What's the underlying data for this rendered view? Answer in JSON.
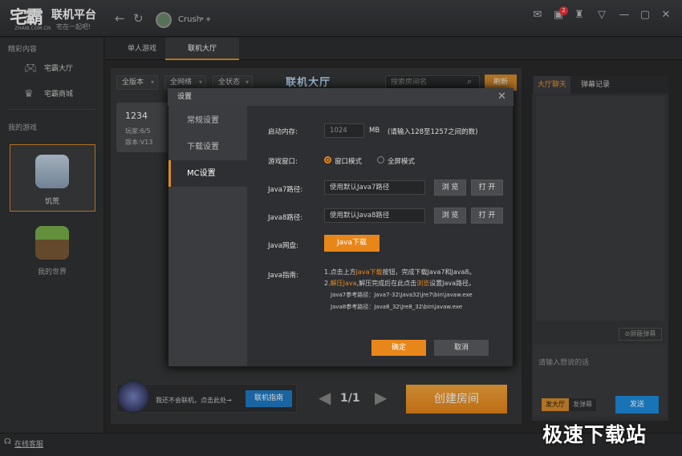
{
  "app": {
    "logo": "宅霸",
    "logo_sub": "ZHAIB.COM.CN",
    "title": "联机平台",
    "slogan": "宅在一起吧!",
    "username": "Crush",
    "badge_count": "2"
  },
  "sidebar": {
    "section1": "精彩内容",
    "items": [
      {
        "label": "宅霸大厅",
        "icon": "gamepad-icon"
      },
      {
        "label": "宅霸商城",
        "icon": "crown-icon"
      }
    ],
    "section2": "我的游戏",
    "games": [
      {
        "name": "饥荒",
        "icon": "dont-starve-icon"
      },
      {
        "name": "我的世界",
        "icon": "minecraft-icon"
      }
    ]
  },
  "tabs": [
    {
      "label": "单人游戏"
    },
    {
      "label": "联机大厅"
    }
  ],
  "hall": {
    "title": "联机大厅",
    "filters": [
      "全版本",
      "全网络",
      "全状态"
    ],
    "search_placeholder": "搜索房间名",
    "refresh": "刷新"
  },
  "room": {
    "name": "1234",
    "players": "玩家:6/5",
    "version": "版本:V13"
  },
  "bottom": {
    "guide_text": "我还不会联机，点击此处→",
    "guide_btn": "联机指南",
    "page": "1/1",
    "create": "创建房间",
    "prev": "◀",
    "next": "▶"
  },
  "right": {
    "tab1": "大厅聊天",
    "tab2": "弹幕记录",
    "block": "屏蔽弹幕",
    "input_placeholder": "请输入想说的话",
    "mode1": "发大厅",
    "mode2": "发弹幕",
    "send": "发送"
  },
  "status": {
    "service": "在线客服"
  },
  "watermark": "极速下载站",
  "dialog": {
    "title": "设置",
    "close": "✕",
    "nav": [
      "常规设置",
      "下载设置",
      "MC设置"
    ],
    "memory_label": "启动内存:",
    "memory_value": "1024",
    "memory_unit": "MB",
    "memory_hint": "(请输入128至1257之间的数)",
    "window_label": "游戏窗口:",
    "window_mode": "窗口模式",
    "fullscreen_mode": "全屏模式",
    "java7_label": "Java7路径:",
    "java7_value": "使用默认Java7路径",
    "java8_label": "Java8路径:",
    "java8_value": "使用默认Java8路径",
    "browse": "浏 览",
    "open": "打 开",
    "java_disk_label": "Java网盘:",
    "java_download": "Java下载",
    "guide_label": "Java指南:",
    "guide": {
      "l1a": "1.点击上方",
      "l1b": "Java下载",
      "l1c": "按钮，完成下载Java7和Java8。",
      "l2a": "2.",
      "l2b": "解压Java",
      "l2c": ",解压完成后在此点击",
      "l2d": "浏览",
      "l2e": "设置Java路径。",
      "l3": "Java7参考路径：Java7-32\\Java32\\jre7\\bin\\javaw.exe",
      "l4": "Java8参考路径：Java8_32\\Jre8_32\\bin\\javaw.exe"
    },
    "ok": "确定",
    "cancel": "取消"
  }
}
